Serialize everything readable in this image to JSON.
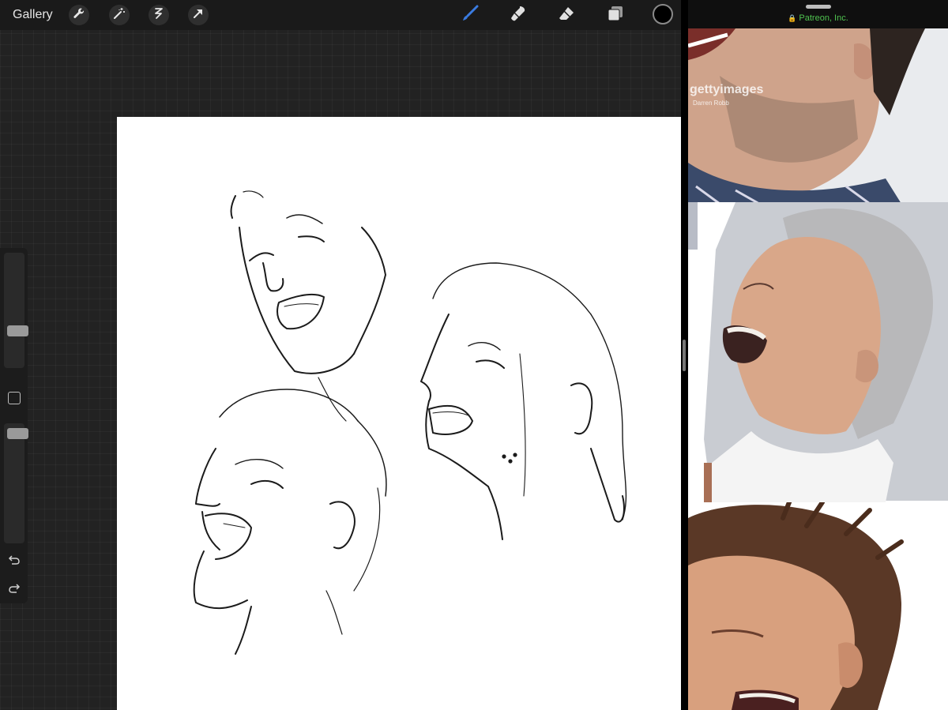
{
  "procreate": {
    "gallery_label": "Gallery",
    "tools_left": [
      {
        "name": "wrench-icon",
        "label": "Actions"
      },
      {
        "name": "magic-wand-icon",
        "label": "Adjustments"
      },
      {
        "name": "selection-icon",
        "label": "Selection"
      },
      {
        "name": "transform-arrow-icon",
        "label": "Transform"
      }
    ],
    "tools_right": [
      {
        "name": "brush-icon",
        "active": true
      },
      {
        "name": "smudge-icon",
        "active": false
      },
      {
        "name": "eraser-icon",
        "active": false
      },
      {
        "name": "layers-icon",
        "active": false
      }
    ],
    "current_color": "#000000",
    "accent_color": "#3a7be0",
    "brush_size_level": 0.3,
    "brush_opacity_level": 0.95
  },
  "browser": {
    "url_label": "Patreon, Inc.",
    "url_color": "#4fc24f",
    "watermark_text": "gettyimages",
    "watermark_credit": "Darren Robb"
  }
}
